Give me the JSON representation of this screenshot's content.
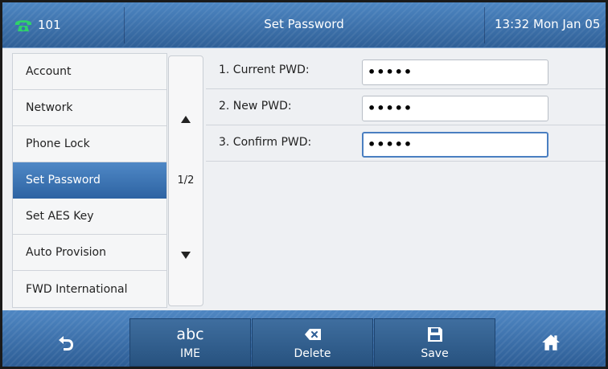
{
  "status_bar": {
    "line_number": "101",
    "screen_title": "Set Password",
    "clock": "13:32 Mon Jan 05",
    "phone_icon": "phone-handset-icon",
    "phone_icon_color": "#2fd16a"
  },
  "menu": {
    "items": [
      {
        "label": "Account",
        "active": false
      },
      {
        "label": "Network",
        "active": false
      },
      {
        "label": "Phone Lock",
        "active": false
      },
      {
        "label": "Set Password",
        "active": true
      },
      {
        "label": "Set AES Key",
        "active": false
      },
      {
        "label": "Auto Provision",
        "active": false
      },
      {
        "label": "FWD International",
        "active": false
      }
    ]
  },
  "pager": {
    "page_indicator": "1/2",
    "up_icon": "arrow-up-icon",
    "down_icon": "arrow-down-icon"
  },
  "form": {
    "fields": [
      {
        "label": "1. Current PWD:",
        "value": "•••••"
      },
      {
        "label": "2. New PWD:",
        "value": "•••••"
      },
      {
        "label": "3. Confirm PWD:",
        "value": "•••••",
        "focused": true
      }
    ]
  },
  "softkeys": {
    "back_icon": "back-arrow-icon",
    "ime_glyph": "abc",
    "ime_label": "IME",
    "delete_icon": "backspace-icon",
    "delete_label": "Delete",
    "save_icon": "floppy-disk-icon",
    "save_label": "Save",
    "home_icon": "home-icon"
  },
  "colors": {
    "header_blue": "#3b6fa8",
    "selected_item": "#3d75b4",
    "input_focus_border": "#4a7fc1"
  }
}
